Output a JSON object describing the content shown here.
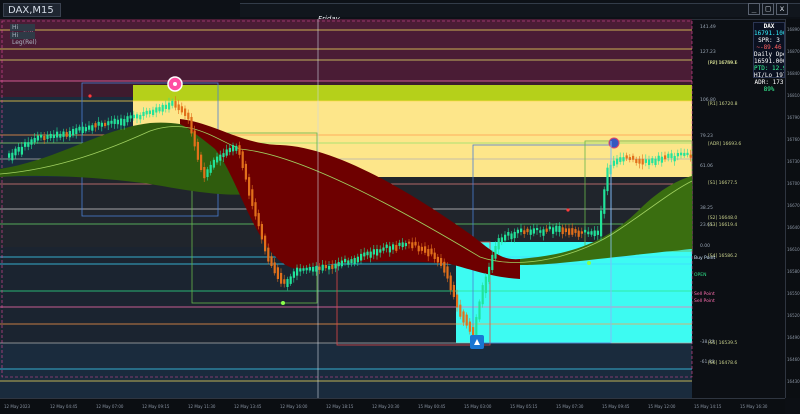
{
  "window": {
    "tab_title": "DAX,M15",
    "day_label": "Friday",
    "minimize": "_",
    "restore": "□",
    "close": "x"
  },
  "top_left_buttons": [
    "Hi Leg(Hi)",
    "Hi Leg(Rel)"
  ],
  "info_panel": {
    "symbol": "DAX",
    "price": "16791.1000",
    "line1": "SPR: 3",
    "line2": "~-89.46",
    "line3": "Daily Open",
    "open_price": "16591.0000",
    "line5": "PTD: 12.9",
    "line6": "HI/Lo 197",
    "line7": "ADR: 173",
    "pct": "89%"
  },
  "levels": [
    {
      "label": "141.49",
      "kind": "left"
    },
    {
      "label": "[PP] 16789.1",
      "kind": "right"
    },
    {
      "label": "127.23",
      "kind": "left"
    },
    {
      "label": "[R2] 16759.6",
      "kind": "right"
    },
    {
      "label": "106.80",
      "kind": "left"
    },
    {
      "label": "[R1] 16720.8",
      "kind": "right"
    },
    {
      "label": "79.23",
      "kind": "left"
    },
    {
      "label": "[ADR] 16693.6",
      "kind": "right"
    },
    {
      "label": "61.06",
      "kind": "left"
    },
    {
      "label": "[S1] 16677.5",
      "kind": "right"
    },
    {
      "label": "38.25",
      "kind": "left"
    },
    {
      "label": "[S2] 16648.0",
      "kind": "right"
    },
    {
      "label": "23.61",
      "kind": "left"
    },
    {
      "label": "[S3] 16619.4",
      "kind": "right"
    },
    {
      "label": "0.00",
      "kind": "left"
    },
    {
      "label": "[S4] 16586.2",
      "kind": "right"
    },
    {
      "label": "-38.20",
      "kind": "left"
    },
    {
      "label": "[S5] 16539.5",
      "kind": "right"
    },
    {
      "label": "-61.80",
      "kind": "left"
    },
    {
      "label": "[S6] 16478.6",
      "kind": "right"
    }
  ],
  "zone_labels": [
    "Buy Point",
    "OPEN",
    "Sell Point",
    "Sell Point"
  ],
  "prices": [
    "16890.1",
    "16870.4",
    "16840.2",
    "16810.6",
    "16790.8",
    "16760.0",
    "16730.3",
    "16700.6",
    "16670.9",
    "16640.1",
    "16610.4",
    "16580.7",
    "16550.9",
    "16520.2",
    "16490.5",
    "16460.8",
    "16430.0"
  ],
  "times": [
    "12 May 2023",
    "12 May 04:45",
    "12 May 07:00",
    "12 May 09:15",
    "12 May 11:30",
    "12 May 13:45",
    "12 May 16:00",
    "12 May 18:15",
    "12 May 20:30",
    "15 May 00:45",
    "15 May 03:00",
    "15 May 05:15",
    "15 May 07:30",
    "15 May 09:45",
    "15 May 12:00",
    "15 May 14:15",
    "15 May 16:30"
  ],
  "colors": {
    "maroon_zone": "#4a1c35",
    "yellow_zone": "#fde68a",
    "yellow_top": "#b5d01a",
    "cyan_zone": "#3dfbf2",
    "dark_zone": "#1a2b3d",
    "bull": "#22e39a",
    "bear": "#e2701b",
    "ma_green": "#3a6e10",
    "ma_red": "#6e0000"
  }
}
